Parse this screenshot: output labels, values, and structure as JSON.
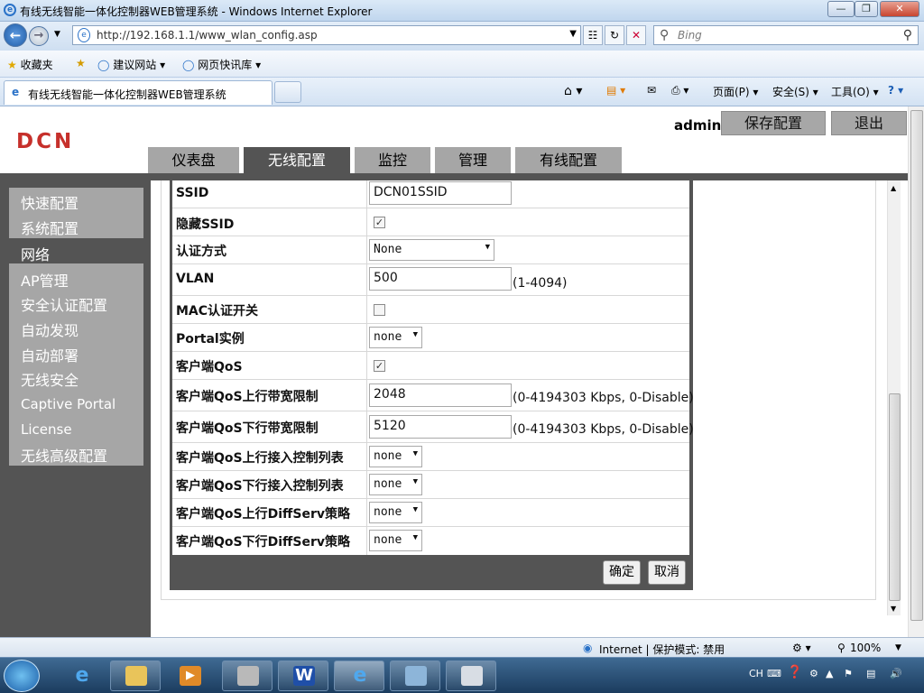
{
  "window": {
    "title": "有线无线智能一体化控制器WEB管理系统 - Windows Internet Explorer"
  },
  "address": {
    "url": "http://192.168.1.1/www_wlan_config.asp",
    "search_placeholder": "Bing"
  },
  "favorites": {
    "favorites_label": "收藏夹",
    "suggested_sites": "建议网站 ▾",
    "web_slice": "网页快讯库 ▾"
  },
  "tab": {
    "title": "有线无线智能一体化控制器WEB管理系统"
  },
  "commands": {
    "page": "页面(P) ▾",
    "safety": "安全(S) ▾",
    "tools": "工具(O) ▾"
  },
  "header": {
    "logo": "DCN",
    "user": "admin",
    "save_label": "保存配置",
    "logout_label": "退出"
  },
  "nav_tabs": [
    "仪表盘",
    "无线配置",
    "监控",
    "管理",
    "有线配置"
  ],
  "sidebar": {
    "items": [
      "快速配置",
      "系统配置",
      "网络",
      "AP管理",
      "安全认证配置",
      "自动发现",
      "自动部署",
      "无线安全",
      "Captive Portal",
      "License",
      "无线高级配置"
    ]
  },
  "form": {
    "ssid": {
      "label": "SSID",
      "value": "DCN01SSID"
    },
    "hide_ssid": {
      "label": "隐藏SSID",
      "checked": true
    },
    "auth": {
      "label": "认证方式",
      "value": "None"
    },
    "vlan": {
      "label": "VLAN",
      "value": "500",
      "hint": "(1-4094)"
    },
    "mac_auth": {
      "label": "MAC认证开关",
      "checked": false
    },
    "portal": {
      "label": "Portal实例",
      "value": "none"
    },
    "client_qos": {
      "label": "客户端QoS",
      "checked": true
    },
    "qos_up_bw": {
      "label": "客户端QoS上行带宽限制",
      "value": "2048",
      "hint": "(0-4194303 Kbps, 0-Disable)"
    },
    "qos_down_bw": {
      "label": "客户端QoS下行带宽限制",
      "value": "5120",
      "hint": "(0-4194303 Kbps, 0-Disable)"
    },
    "qos_up_acl": {
      "label": "客户端QoS上行接入控制列表",
      "value": "none"
    },
    "qos_down_acl": {
      "label": "客户端QoS下行接入控制列表",
      "value": "none"
    },
    "qos_up_diffserv": {
      "label": "客户端QoS上行DiffServ策略",
      "value": "none"
    },
    "qos_down_diffserv": {
      "label": "客户端QoS下行DiffServ策略",
      "value": "none"
    },
    "ok_label": "确定",
    "cancel_label": "取消"
  },
  "status": {
    "zone": "Internet | 保护模式: 禁用",
    "zoom": "100%"
  },
  "taskbar": {
    "lang": "CH"
  }
}
